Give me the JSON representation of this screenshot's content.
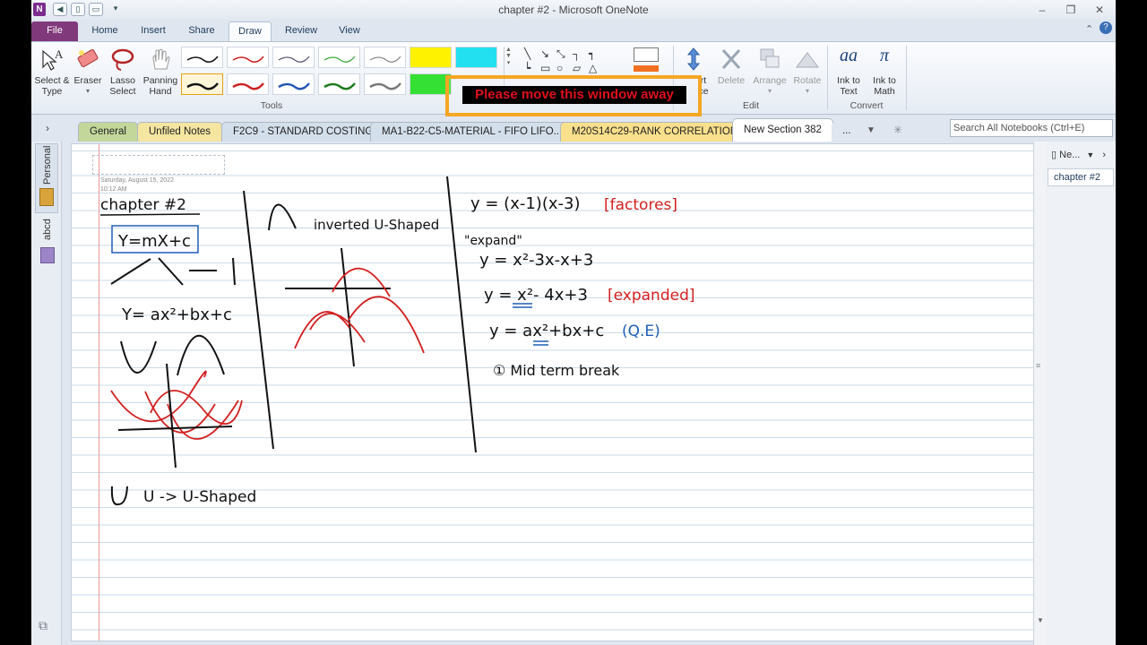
{
  "window": {
    "title": "chapter #2 - Microsoft OneNote",
    "app_icon": "N"
  },
  "ribbon_tabs": [
    {
      "label": "File"
    },
    {
      "label": "Home"
    },
    {
      "label": "Insert"
    },
    {
      "label": "Share"
    },
    {
      "label": "Draw"
    },
    {
      "label": "Review"
    },
    {
      "label": "View"
    }
  ],
  "ribbon": {
    "tools": {
      "select_type": "Select & Type",
      "eraser": "Eraser",
      "lasso": "Lasso Select",
      "panning": "Panning Hand",
      "group_label": "Tools"
    },
    "edit": {
      "insert_space_partial": "rt",
      "insert_space_partial2": "ce",
      "delete": "Delete",
      "arrange": "Arrange",
      "rotate": "Rotate",
      "group_label": "Edit"
    },
    "convert": {
      "ink_to_text": "Ink to Text",
      "ink_to_math": "Ink to Math",
      "group_label": "Convert",
      "ink_to_text_glyph": "aa",
      "ink_to_math_glyph": "π"
    }
  },
  "sections": [
    {
      "label": "General",
      "color": "#c4d79b"
    },
    {
      "label": "Unfiled Notes",
      "color": "#f4e5a1"
    },
    {
      "label": "F2C9 - STANDARD COSTING",
      "color": "#d4dfec"
    },
    {
      "label": "MA1-B22-C5-MATERIAL - FIFO LIFO...",
      "color": "#d4dfec"
    },
    {
      "label": "M20S14C29-RANK CORRELATION",
      "color": "#f9e08c"
    },
    {
      "label": "New Section 382",
      "color": "#ffffff"
    },
    {
      "label": "...",
      "color": "#dfe6ef"
    }
  ],
  "search": {
    "placeholder": "Search All Notebooks (Ctrl+E)"
  },
  "notebooks": [
    {
      "label": "Personal"
    },
    {
      "label": "abcd"
    }
  ],
  "page": {
    "date": "Saturday, August 15, 2022",
    "time": "10:12 AM"
  },
  "page_panel": {
    "new_page": "Ne...",
    "pages": [
      {
        "label": "chapter #2"
      }
    ]
  },
  "overlay": {
    "message": "Please move this window away"
  },
  "ink": {
    "title": "chapter #2",
    "linear": "Y=mX+c",
    "quadratic": "Y= ax²+bx+c",
    "inverted": "inverted U-Shaped",
    "ushaped": "U  -> U-Shaped",
    "eq1": "y = (x-1)(x-3)",
    "eq1_tag": "[factores]",
    "expand": "\"expand\"",
    "eq2": "y = x²-3x-x+3",
    "eq3": "y = x²- 4x+3",
    "eq3_tag": "[expanded]",
    "eq4": "y = ax²+bx+c",
    "eq4_tag": "(Q.E)",
    "mid_term": "① Mid term break"
  },
  "colors": {
    "accent": "#80397b",
    "ink_black": "#111111",
    "ink_red": "#d32020",
    "ink_blue": "#1f5fb5",
    "overlay_border": "#f5a623"
  }
}
